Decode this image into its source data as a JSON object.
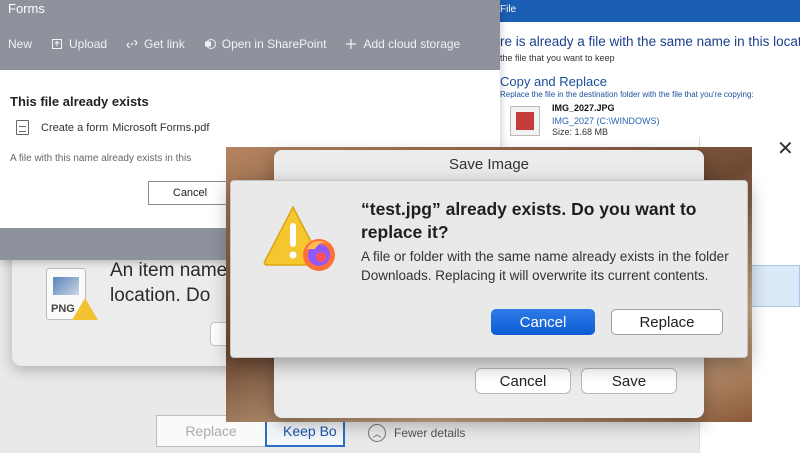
{
  "forms": {
    "window_title": "Forms",
    "toolbar": [
      {
        "label": "New",
        "icon": "none"
      },
      {
        "label": "Upload",
        "icon": "upload-icon"
      },
      {
        "label": "Get link",
        "icon": "link-icon"
      },
      {
        "label": "Open in SharePoint",
        "icon": "sharepoint-icon"
      },
      {
        "label": "Add cloud storage",
        "icon": "plus-icon"
      }
    ],
    "heading": "This file already exists",
    "file_path": "Create a form",
    "file_name": "Microsoft Forms.pdf",
    "message": "A file with this name already exists in this",
    "cancel_label": "Cancel"
  },
  "windows_dialog": {
    "title": "File",
    "heading": "re is already a file with the same name in this location.",
    "sub": "the file that you want to keep",
    "copy_replace": "Copy and Replace",
    "copy_replace_desc": "Replace the file in the destination folder with the file that you're copying:",
    "file_name": "IMG_2027.JPG",
    "file_path": "IMG_2027 (C:\\WINDOWS)",
    "file_size": "Size: 1.68 MB",
    "replace_label": "Replace",
    "keep_label": "Keep Bo",
    "fewer_details": "Fewer details"
  },
  "mac_bg_dialog": {
    "text": "An item name\nlocation. Do",
    "file_icon_label": "PNG"
  },
  "save_image": {
    "title": "Save Image",
    "cancel_label": "Cancel",
    "save_label": "Save"
  },
  "alert": {
    "heading": "“test.jpg” already exists. Do you want to replace it?",
    "body": "A file or folder with the same name already exists in the folder Downloads. Replacing it will overwrite its current contents.",
    "cancel_label": "Cancel",
    "replace_label": "Replace"
  },
  "colors": {
    "accent_blue": "#0b5cd5",
    "windows_blue": "#1a5fb4",
    "forms_header_gray": "#8e929c",
    "warning_yellow": "#f2c230"
  }
}
